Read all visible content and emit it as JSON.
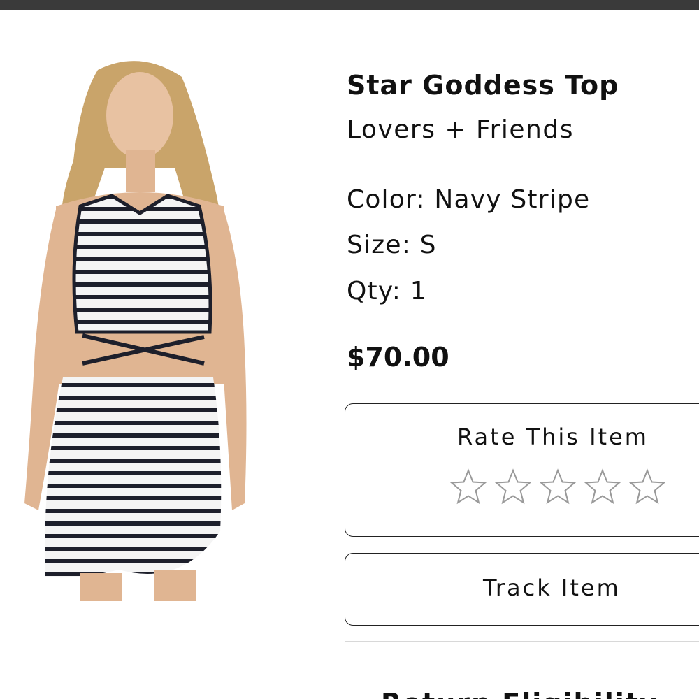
{
  "product": {
    "name": "Star Goddess Top",
    "brand": "Lovers + Friends",
    "color": "Color: Navy Stripe",
    "size": "Size: S",
    "qty": "Qty: 1",
    "price": "$70.00",
    "image_icon": "product-photo-striped-outfit"
  },
  "rating": {
    "label": "Rate This Item",
    "max_stars": 5,
    "current": 0
  },
  "actions": {
    "track_label": "Track Item"
  },
  "sections": {
    "return_heading": "Return Eligibility"
  },
  "colors": {
    "top_bar": "#3a3a3a",
    "text": "#111111",
    "star_outline": "#9a9a9a",
    "border": "#222222",
    "divider": "#d8d8d8"
  }
}
